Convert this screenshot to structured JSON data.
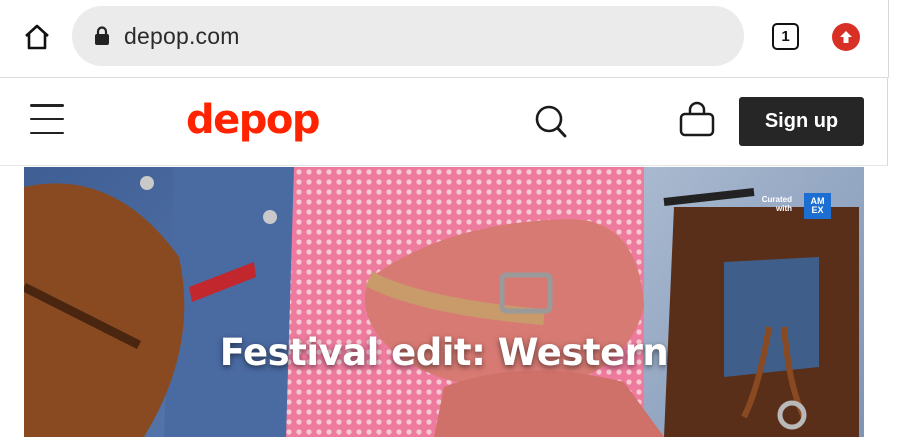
{
  "browser": {
    "url": "depop.com",
    "tab_count": "1",
    "icons": {
      "home": "home-icon",
      "lock": "lock-icon",
      "update": "arrow-up-icon"
    }
  },
  "header": {
    "logo": "depop",
    "signup_label": "Sign up",
    "icons": {
      "menu": "hamburger-menu-icon",
      "search": "search-icon",
      "bag": "shopping-bag-icon"
    },
    "brand_color": "#ff2300"
  },
  "hero": {
    "title": "Festival edit: Western",
    "curated_label": "Curated with",
    "amex_label": "AM EX"
  }
}
